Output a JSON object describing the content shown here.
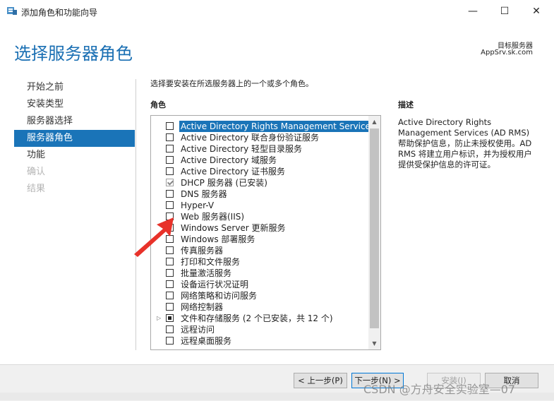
{
  "window": {
    "title": "添加角色和功能向导",
    "minimize": "—",
    "maximize": "☐",
    "close": "✕"
  },
  "header": {
    "title": "选择服务器角色",
    "target_label": "目标服务器",
    "target_host": "AppSrv.sk.com"
  },
  "nav": {
    "items": [
      {
        "label": "开始之前",
        "state": "normal"
      },
      {
        "label": "安装类型",
        "state": "normal"
      },
      {
        "label": "服务器选择",
        "state": "normal"
      },
      {
        "label": "服务器角色",
        "state": "active"
      },
      {
        "label": "功能",
        "state": "normal"
      },
      {
        "label": "确认",
        "state": "disabled"
      },
      {
        "label": "结果",
        "state": "disabled"
      }
    ]
  },
  "main": {
    "instruction": "选择要安装在所选服务器上的一个或多个角色。",
    "roles_heading": "角色",
    "roles": [
      {
        "label": "Active Directory Rights Management Services",
        "checked": false,
        "selected": true
      },
      {
        "label": "Active Directory 联合身份验证服务",
        "checked": false
      },
      {
        "label": "Active Directory 轻型目录服务",
        "checked": false
      },
      {
        "label": "Active Directory 域服务",
        "checked": false
      },
      {
        "label": "Active Directory 证书服务",
        "checked": false
      },
      {
        "label": "DHCP 服务器 (已安装)",
        "checked": true
      },
      {
        "label": "DNS 服务器",
        "checked": false
      },
      {
        "label": "Hyper-V",
        "checked": false
      },
      {
        "label": "Web 服务器(IIS)",
        "checked": false
      },
      {
        "label": "Windows Server 更新服务",
        "checked": false
      },
      {
        "label": "Windows 部署服务",
        "checked": false
      },
      {
        "label": "传真服务器",
        "checked": false
      },
      {
        "label": "打印和文件服务",
        "checked": false
      },
      {
        "label": "批量激活服务",
        "checked": false
      },
      {
        "label": "设备运行状况证明",
        "checked": false
      },
      {
        "label": "网络策略和访问服务",
        "checked": false
      },
      {
        "label": "网络控制器",
        "checked": false
      },
      {
        "label": "文件和存储服务 (2 个已安装，共 12 个)",
        "checked": "partial",
        "expandable": true
      },
      {
        "label": "远程访问",
        "checked": false
      },
      {
        "label": "远程桌面服务",
        "checked": false
      }
    ]
  },
  "description": {
    "heading": "描述",
    "text": "Active Directory Rights Management Services (AD RMS) 帮助保护信息，防止未授权使用。AD RMS 将建立用户标识，并为授权用户提供受保护信息的许可证。"
  },
  "footer": {
    "prev": "< 上一步(P)",
    "next": "下一步(N) >",
    "install": "安装(I)",
    "cancel": "取消"
  },
  "watermark": "CSDN @方舟安全实验室—07",
  "colors": {
    "accent": "#1a74b8",
    "title": "#1a6fb3",
    "arrow": "#e8322a"
  }
}
